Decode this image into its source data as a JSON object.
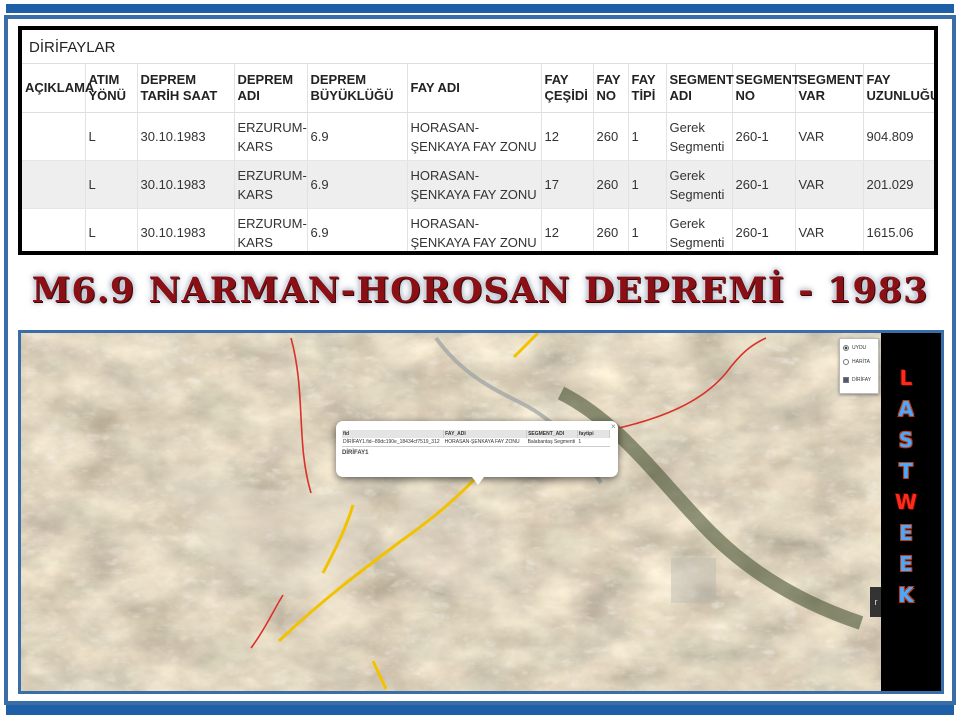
{
  "table": {
    "title": "DİRİFAYLAR",
    "columns": [
      "AÇIKLAMA",
      "ATIM YÖNÜ",
      "DEPREM TARİH SAAT",
      "DEPREM ADI",
      "DEPREM BÜYÜKLÜĞÜ",
      "FAY ADI",
      "FAY ÇEŞİDİ",
      "FAY NO",
      "FAY TİPİ",
      "SEGMENT ADI",
      "SEGMENT NO",
      "SEGMENT VAR",
      "FAY UZUNLUĞU"
    ],
    "rows": [
      [
        "",
        "L",
        "30.10.1983",
        "ERZURUM-KARS",
        "6.9",
        "HORASAN-ŞENKAYA FAY ZONU",
        "12",
        "260",
        "1",
        "Gerek Segmenti",
        "260-1",
        "VAR",
        "904.809"
      ],
      [
        "",
        "L",
        "30.10.1983",
        "ERZURUM-KARS",
        "6.9",
        "HORASAN-ŞENKAYA FAY ZONU",
        "17",
        "260",
        "1",
        "Gerek Segmenti",
        "260-1",
        "VAR",
        "201.029"
      ],
      [
        "",
        "L",
        "30.10.1983",
        "ERZURUM-KARS",
        "6.9",
        "HORASAN-ŞENKAYA FAY ZONU",
        "12",
        "260",
        "1",
        "Gerek Segmenti",
        "260-1",
        "VAR",
        "1615.06"
      ]
    ]
  },
  "banner": {
    "title": "M6.9 NARMAN-HOROSAN DEPREMİ - 1983"
  },
  "map": {
    "layers": {
      "uydu": "UYDU",
      "harita": "HARİTA",
      "dirifay": "DİRİFAY"
    },
    "popup": {
      "headers": [
        "fid",
        "FAY_ADI",
        "SEGMENT_ADI",
        "faytipi"
      ],
      "values": [
        "DİRİFAY1.fid--89dc190e_18434cf7519_312",
        "HORASAN-ŞENKAYA FAY ZONU",
        "Balabantaş Segmenti",
        "1"
      ],
      "layer_name": "DİRİFAY1",
      "close": "×"
    },
    "side_word": [
      "L",
      "A",
      "S",
      "T",
      "W",
      "E",
      "E",
      "K"
    ],
    "arrow": "r",
    "colors": {
      "fault_line": "#f2c200",
      "boundary_line": "#d9322a"
    }
  }
}
